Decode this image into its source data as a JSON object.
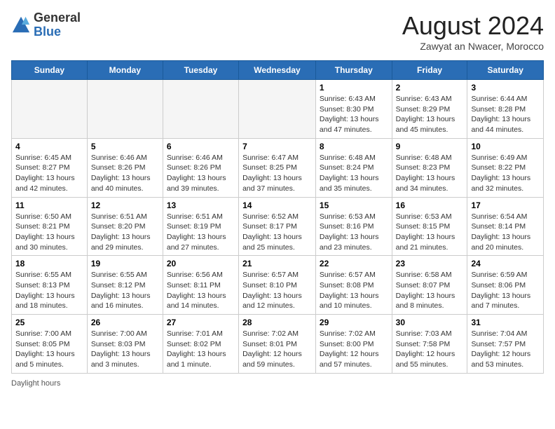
{
  "header": {
    "logo_general": "General",
    "logo_blue": "Blue",
    "title": "August 2024",
    "subtitle": "Zawyat an Nwacer, Morocco"
  },
  "days_of_week": [
    "Sunday",
    "Monday",
    "Tuesday",
    "Wednesday",
    "Thursday",
    "Friday",
    "Saturday"
  ],
  "weeks": [
    [
      {
        "day": "",
        "info": ""
      },
      {
        "day": "",
        "info": ""
      },
      {
        "day": "",
        "info": ""
      },
      {
        "day": "",
        "info": ""
      },
      {
        "day": "1",
        "info": "Sunrise: 6:43 AM\nSunset: 8:30 PM\nDaylight: 13 hours and 47 minutes."
      },
      {
        "day": "2",
        "info": "Sunrise: 6:43 AM\nSunset: 8:29 PM\nDaylight: 13 hours and 45 minutes."
      },
      {
        "day": "3",
        "info": "Sunrise: 6:44 AM\nSunset: 8:28 PM\nDaylight: 13 hours and 44 minutes."
      }
    ],
    [
      {
        "day": "4",
        "info": "Sunrise: 6:45 AM\nSunset: 8:27 PM\nDaylight: 13 hours and 42 minutes."
      },
      {
        "day": "5",
        "info": "Sunrise: 6:46 AM\nSunset: 8:26 PM\nDaylight: 13 hours and 40 minutes."
      },
      {
        "day": "6",
        "info": "Sunrise: 6:46 AM\nSunset: 8:26 PM\nDaylight: 13 hours and 39 minutes."
      },
      {
        "day": "7",
        "info": "Sunrise: 6:47 AM\nSunset: 8:25 PM\nDaylight: 13 hours and 37 minutes."
      },
      {
        "day": "8",
        "info": "Sunrise: 6:48 AM\nSunset: 8:24 PM\nDaylight: 13 hours and 35 minutes."
      },
      {
        "day": "9",
        "info": "Sunrise: 6:48 AM\nSunset: 8:23 PM\nDaylight: 13 hours and 34 minutes."
      },
      {
        "day": "10",
        "info": "Sunrise: 6:49 AM\nSunset: 8:22 PM\nDaylight: 13 hours and 32 minutes."
      }
    ],
    [
      {
        "day": "11",
        "info": "Sunrise: 6:50 AM\nSunset: 8:21 PM\nDaylight: 13 hours and 30 minutes."
      },
      {
        "day": "12",
        "info": "Sunrise: 6:51 AM\nSunset: 8:20 PM\nDaylight: 13 hours and 29 minutes."
      },
      {
        "day": "13",
        "info": "Sunrise: 6:51 AM\nSunset: 8:19 PM\nDaylight: 13 hours and 27 minutes."
      },
      {
        "day": "14",
        "info": "Sunrise: 6:52 AM\nSunset: 8:17 PM\nDaylight: 13 hours and 25 minutes."
      },
      {
        "day": "15",
        "info": "Sunrise: 6:53 AM\nSunset: 8:16 PM\nDaylight: 13 hours and 23 minutes."
      },
      {
        "day": "16",
        "info": "Sunrise: 6:53 AM\nSunset: 8:15 PM\nDaylight: 13 hours and 21 minutes."
      },
      {
        "day": "17",
        "info": "Sunrise: 6:54 AM\nSunset: 8:14 PM\nDaylight: 13 hours and 20 minutes."
      }
    ],
    [
      {
        "day": "18",
        "info": "Sunrise: 6:55 AM\nSunset: 8:13 PM\nDaylight: 13 hours and 18 minutes."
      },
      {
        "day": "19",
        "info": "Sunrise: 6:55 AM\nSunset: 8:12 PM\nDaylight: 13 hours and 16 minutes."
      },
      {
        "day": "20",
        "info": "Sunrise: 6:56 AM\nSunset: 8:11 PM\nDaylight: 13 hours and 14 minutes."
      },
      {
        "day": "21",
        "info": "Sunrise: 6:57 AM\nSunset: 8:10 PM\nDaylight: 13 hours and 12 minutes."
      },
      {
        "day": "22",
        "info": "Sunrise: 6:57 AM\nSunset: 8:08 PM\nDaylight: 13 hours and 10 minutes."
      },
      {
        "day": "23",
        "info": "Sunrise: 6:58 AM\nSunset: 8:07 PM\nDaylight: 13 hours and 8 minutes."
      },
      {
        "day": "24",
        "info": "Sunrise: 6:59 AM\nSunset: 8:06 PM\nDaylight: 13 hours and 7 minutes."
      }
    ],
    [
      {
        "day": "25",
        "info": "Sunrise: 7:00 AM\nSunset: 8:05 PM\nDaylight: 13 hours and 5 minutes."
      },
      {
        "day": "26",
        "info": "Sunrise: 7:00 AM\nSunset: 8:03 PM\nDaylight: 13 hours and 3 minutes."
      },
      {
        "day": "27",
        "info": "Sunrise: 7:01 AM\nSunset: 8:02 PM\nDaylight: 13 hours and 1 minute."
      },
      {
        "day": "28",
        "info": "Sunrise: 7:02 AM\nSunset: 8:01 PM\nDaylight: 12 hours and 59 minutes."
      },
      {
        "day": "29",
        "info": "Sunrise: 7:02 AM\nSunset: 8:00 PM\nDaylight: 12 hours and 57 minutes."
      },
      {
        "day": "30",
        "info": "Sunrise: 7:03 AM\nSunset: 7:58 PM\nDaylight: 12 hours and 55 minutes."
      },
      {
        "day": "31",
        "info": "Sunrise: 7:04 AM\nSunset: 7:57 PM\nDaylight: 12 hours and 53 minutes."
      }
    ]
  ],
  "footer": {
    "note": "Daylight hours"
  }
}
